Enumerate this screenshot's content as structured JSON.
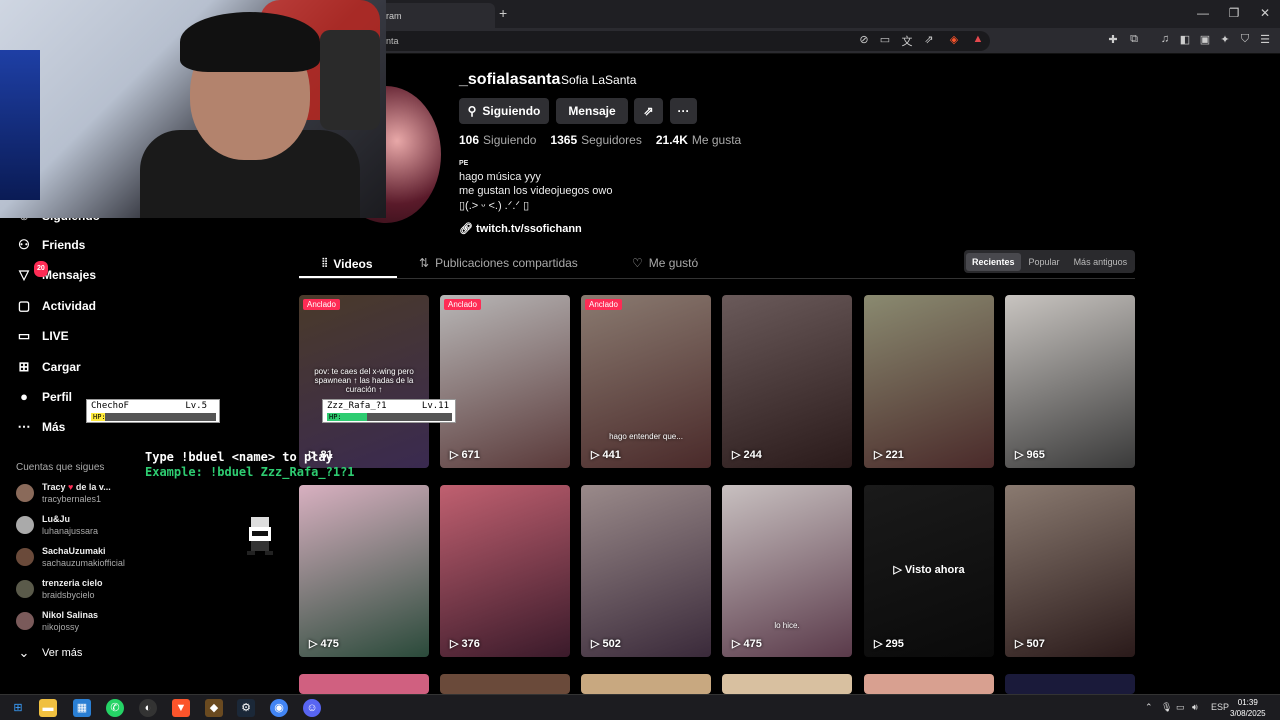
{
  "browser": {
    "tab_title": "ram",
    "new_tab": "+",
    "url": "nta",
    "window_controls": {
      "minimize": "—",
      "restore": "❐",
      "close": "✕"
    }
  },
  "sidebar": {
    "items": [
      {
        "label": "Siguiendo",
        "icon": "following-icon"
      },
      {
        "label": "Friends",
        "icon": "friends-icon"
      },
      {
        "label": "Mensajes",
        "icon": "messages-icon",
        "badge": "20"
      },
      {
        "label": "Actividad",
        "icon": "activity-icon"
      },
      {
        "label": "LIVE",
        "icon": "live-icon"
      },
      {
        "label": "Cargar",
        "icon": "upload-icon"
      },
      {
        "label": "Perfil",
        "icon": "profile-icon"
      },
      {
        "label": "Más",
        "icon": "more-icon"
      }
    ],
    "following_title": "Cuentas que sigues",
    "following": [
      {
        "name": "Tracy",
        "name_suffix": "de la v...",
        "handle": "tracybernales1"
      },
      {
        "name": "Lu&Ju",
        "handle": "luhanajussara"
      },
      {
        "name": "SachaUzumaki",
        "handle": "sachauzumakiofficial"
      },
      {
        "name": "trenzeria cielo",
        "handle": "braidsbycielo"
      },
      {
        "name": "Nikol Salinas",
        "handle": "nikojossy"
      }
    ],
    "see_more": "Ver más"
  },
  "game_overlay": {
    "card1_name": "ChechoF",
    "card1_level": "Lv.5",
    "card1_hp": "HP:",
    "card2_name": "Zzz_Rafa_?1",
    "card2_level": "Lv.11",
    "card2_hp": "HP:",
    "line1": "Type !bduel <name> to play",
    "line2": "Example: !bduel Zzz_Rafa_?1?1"
  },
  "profile": {
    "username": "_sofialasanta",
    "display_name": "Sofia LaSanta",
    "following_btn": "Siguiendo",
    "message_btn": "Mensaje",
    "share_icon": "share-icon",
    "more_btn": "···",
    "stats": {
      "following_count": "106",
      "following_label": "Siguiendo",
      "followers_count": "1365",
      "followers_label": "Seguidores",
      "likes_count": "21.4K",
      "likes_label": "Me gusta"
    },
    "bio_flag": "PE",
    "bio_line1": "hago música yyy",
    "bio_line2": "me gustan los videojuegos owo",
    "bio_line3": "▯(.> ᵕ <.) .ᐟ.ᐟ ▯",
    "link": "twitch.tv/ssofichann"
  },
  "tabs": {
    "videos": "Videos",
    "shared": "Publicaciones compartidas",
    "liked": "Me gustó"
  },
  "sort": {
    "recent": "Recientes",
    "popular": "Popular",
    "oldest": "Más antiguos"
  },
  "videos_row1": [
    {
      "views": "81",
      "pinned": "Anclado",
      "caption": "pov: te caes del x-wing pero spawnean ↑ las hadas de la curación ↑",
      "colors": [
        "#4a3a2a",
        "#3a2a50"
      ]
    },
    {
      "views": "671",
      "pinned": "Anclado",
      "caption": "",
      "colors": [
        "#b8b6b6",
        "#5a3a3a"
      ]
    },
    {
      "views": "441",
      "pinned": "Anclado",
      "caption": "hago entender que...",
      "colors": [
        "#8a7a70",
        "#4a2a2a"
      ]
    },
    {
      "views": "244",
      "pinned": "",
      "caption": "",
      "colors": [
        "#6a5a5a",
        "#2a1a1a"
      ]
    },
    {
      "views": "221",
      "pinned": "",
      "caption": "",
      "colors": [
        "#8a8a70",
        "#4a2a2a"
      ]
    },
    {
      "views": "965",
      "pinned": "",
      "caption": "",
      "colors": [
        "#c8c4c0",
        "#3a3a3a"
      ]
    }
  ],
  "videos_row2": [
    {
      "views": "475",
      "caption": "",
      "colors": [
        "#d8b0c0",
        "#2a4a3a"
      ]
    },
    {
      "views": "376",
      "caption": "",
      "colors": [
        "#c06070",
        "#3a1a2a"
      ]
    },
    {
      "views": "502",
      "caption": "",
      "colors": [
        "#9a8a8a",
        "#3a2a3a"
      ]
    },
    {
      "views": "475",
      "caption": "lo hice.",
      "colors": [
        "#c8c0c0",
        "#5a3a4a"
      ]
    },
    {
      "views": "295",
      "caption": "",
      "seen": "Visto ahora",
      "colors": [
        "#1a1a1a",
        "#0a0a0a"
      ]
    },
    {
      "views": "507",
      "caption": "",
      "colors": [
        "#8a7a70",
        "#2a1a1a"
      ]
    }
  ],
  "taskbar": {
    "lang": "ESP",
    "time": "01:39",
    "date": "3/08/2025"
  }
}
